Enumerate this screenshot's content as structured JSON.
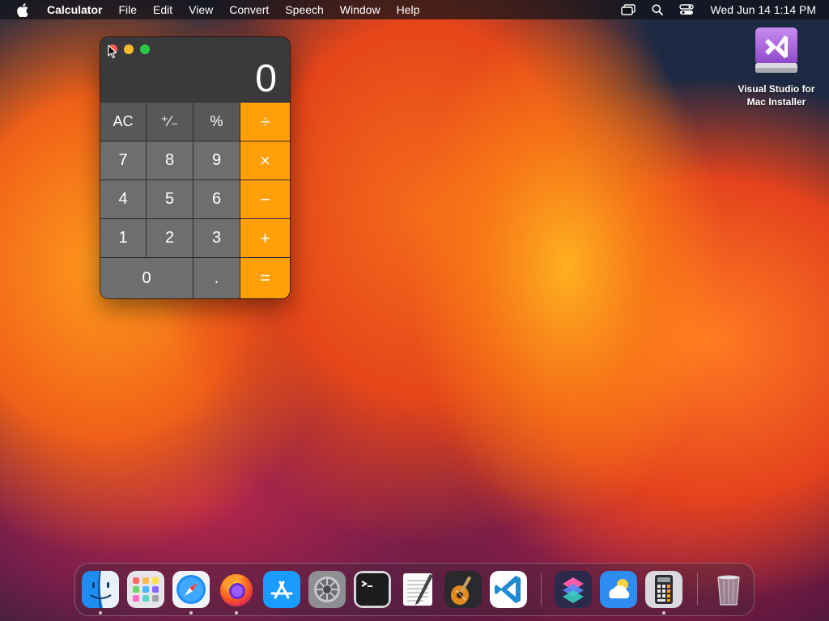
{
  "menubar": {
    "app_name": "Calculator",
    "items": [
      "File",
      "Edit",
      "View",
      "Convert",
      "Speech",
      "Window",
      "Help"
    ],
    "clock": "Wed Jun 14  1:14 PM"
  },
  "desktop_icon": {
    "label_line1": "Visual Studio for",
    "label_line2": "Mac Installer"
  },
  "calculator": {
    "display": "0",
    "keys": {
      "ac": "AC",
      "sign": "⁺∕₋",
      "percent": "%",
      "divide": "÷",
      "seven": "7",
      "eight": "8",
      "nine": "9",
      "multiply": "×",
      "four": "4",
      "five": "5",
      "six": "6",
      "minus": "−",
      "one": "1",
      "two": "2",
      "three": "3",
      "plus": "+",
      "zero": "0",
      "decimal": ".",
      "equals": "="
    }
  },
  "dock": {
    "items": [
      "Finder",
      "Launchpad",
      "Safari",
      "Firefox",
      "App Store",
      "System Settings",
      "Terminal",
      "TextEdit",
      "GarageBand",
      "Visual Studio Code",
      "Shortcuts",
      "Weather",
      "Calculator",
      "Trash"
    ]
  },
  "colors": {
    "operator_orange": "#ff9f0a",
    "digit_gray": "#6e6e70",
    "function_gray": "#58585a"
  }
}
